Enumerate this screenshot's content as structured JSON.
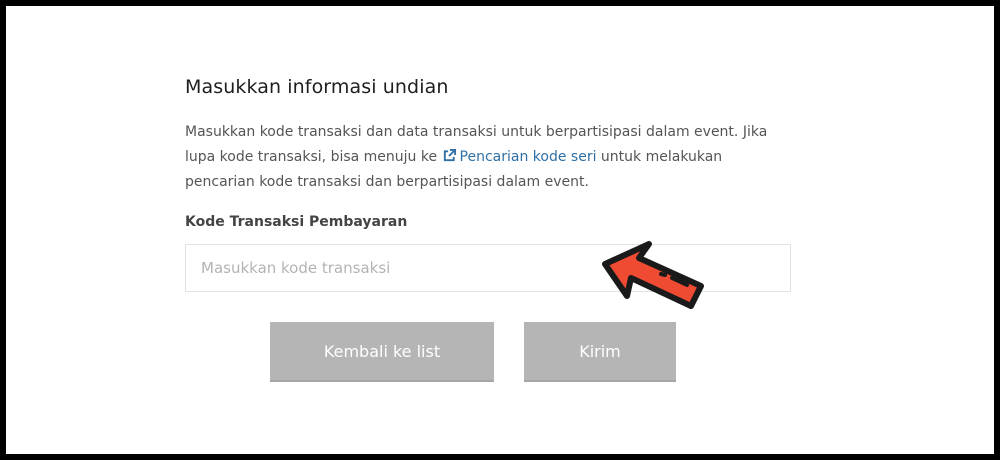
{
  "form": {
    "title": "Masukkan informasi undian",
    "description_part1": "Masukkan kode transaksi dan data transaksi untuk berpartisipasi dalam event. Jika lupa kode transaksi, bisa menuju ke ",
    "link_text": "Pencarian kode seri",
    "description_part2": " untuk melakukan pencarian kode transaksi dan berpartisipasi dalam event.",
    "field_label": "Kode Transaksi Pembayaran",
    "field_placeholder": "Masukkan kode transaksi",
    "field_value": ""
  },
  "buttons": {
    "back_label": "Kembali ke list",
    "submit_label": "Kirim"
  },
  "icons": {
    "link_icon": "external-link-icon",
    "annotation": "red-arrow-icon"
  },
  "colors": {
    "link": "#2f6fa4",
    "button_bg": "#b5b5b5",
    "arrow": "#ef4b33"
  }
}
